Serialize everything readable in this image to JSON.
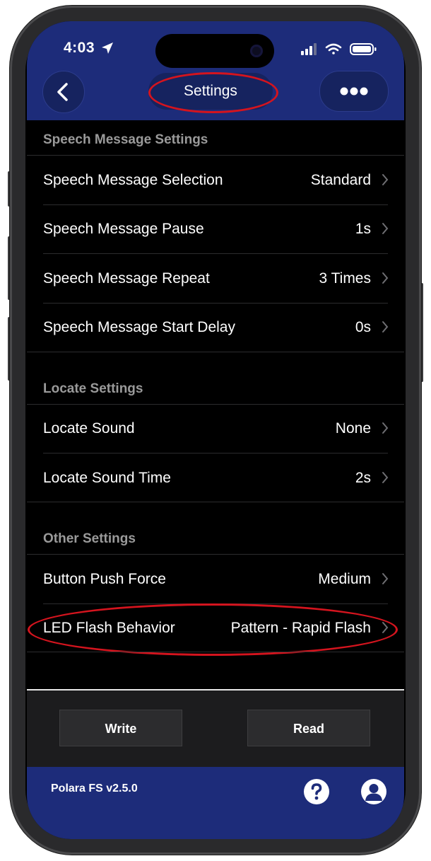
{
  "status_bar": {
    "time": "4:03"
  },
  "header": {
    "title": "Settings"
  },
  "sections": [
    {
      "title": "Speech Message Settings",
      "rows": [
        {
          "label": "Speech Message Selection",
          "value": "Standard"
        },
        {
          "label": "Speech Message Pause",
          "value": "1s"
        },
        {
          "label": "Speech Message Repeat",
          "value": "3 Times"
        },
        {
          "label": "Speech Message Start Delay",
          "value": "0s"
        }
      ]
    },
    {
      "title": "Locate Settings",
      "rows": [
        {
          "label": "Locate Sound",
          "value": "None"
        },
        {
          "label": "Locate Sound Time",
          "value": "2s"
        }
      ]
    },
    {
      "title": "Other Settings",
      "rows": [
        {
          "label": "Button Push Force",
          "value": "Medium"
        },
        {
          "label": "LED Flash Behavior",
          "value": "Pattern - Rapid Flash"
        }
      ]
    }
  ],
  "actions": {
    "write_label": "Write",
    "read_label": "Read"
  },
  "footer": {
    "version": "Polara FS v2.5.0"
  },
  "icons": {
    "back": "chevron-left-icon",
    "more": "more-horizontal-icon",
    "row_disclosure": "chevron-right-icon",
    "help": "question-circle-icon",
    "profile": "user-circle-icon",
    "location": "location-arrow-icon",
    "signal": "cellular-signal-icon",
    "wifi": "wifi-icon",
    "battery": "battery-icon"
  },
  "colors": {
    "header_bg": "#1d2c7a",
    "screen_bg": "#000000",
    "annotation_ring": "#d4141e",
    "section_title": "#9a9a9a"
  }
}
